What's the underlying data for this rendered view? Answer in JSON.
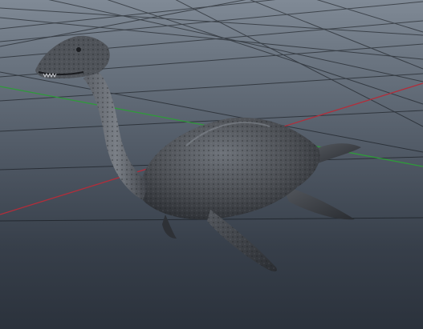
{
  "viewport": {
    "background_top": "#808a96",
    "background_bottom": "#2b323c",
    "grid_color": "#0d1014",
    "axis_x_color": "#b32d3a",
    "axis_z_color": "#2f9a3a"
  },
  "model": {
    "subject": "plesiosaur",
    "skin_color": "#4a4d52",
    "dark_color": "#25282d",
    "light_color": "#7a7f86"
  }
}
